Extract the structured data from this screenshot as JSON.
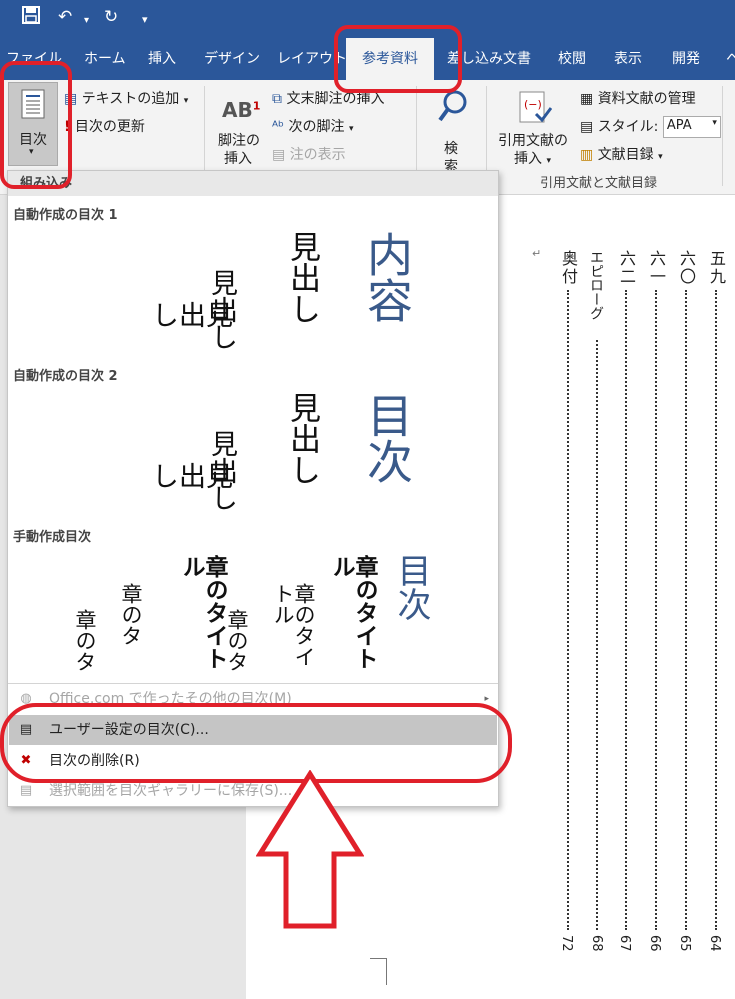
{
  "qat": {
    "save_icon": "save-icon",
    "undo_icon": "undo-icon",
    "redo_icon": "redo-icon",
    "more_icon": "customize-qat-icon"
  },
  "tabs": [
    {
      "label": "ファイル"
    },
    {
      "label": "ホーム"
    },
    {
      "label": "挿入"
    },
    {
      "label": "デザイン"
    },
    {
      "label": "レイアウト"
    },
    {
      "label": "参考資料"
    },
    {
      "label": "差し込み文書"
    },
    {
      "label": "校閲"
    },
    {
      "label": "表示"
    },
    {
      "label": "開発"
    },
    {
      "label": "ヘ"
    }
  ],
  "ribbon": {
    "toc_label": "目次",
    "add_text": "テキストの追加",
    "update_toc": "目次の更新",
    "footnote_insert_line1": "脚注の",
    "footnote_insert_line2": "挿入",
    "endnote_insert": "文末脚注の挿入",
    "next_footnote": "次の脚注",
    "show_notes": "注の表示",
    "search_line1": "検",
    "search_line2": "索",
    "citation_line1": "引用文献の",
    "citation_line2": "挿入",
    "manage_sources": "資料文献の管理",
    "style_label": "スタイル:",
    "style_value": "APA",
    "bibliography": "文献目録",
    "group_citations": "引用文献と文献目録"
  },
  "menu": {
    "header": "組み込み",
    "sections": {
      "auto1": {
        "title": "自動作成の目次 1",
        "big": "内容",
        "h1": "見出し",
        "h2": "見出し",
        "h3": "見出し"
      },
      "auto2": {
        "title": "自動作成の目次 2",
        "big": "目次",
        "h1": "見出し",
        "h2": "見出し",
        "h3": "見出し"
      },
      "manual": {
        "title": "手動作成目次",
        "big": "目次",
        "c1": "章のタイトル",
        "c2": "章のタイトル",
        "c3": "章のタ",
        "c4": "章のタイトル",
        "c5": "章のタ",
        "c6": "章のタ"
      }
    },
    "items": {
      "more": "Office.com で作ったその他の目次(M)",
      "custom": "ユーザー設定の目次(C)...",
      "remove": "目次の削除(R)",
      "save": "選択範囲を目次ギャラリーに保存(S)..."
    }
  },
  "document": {
    "columns": [
      {
        "text": "五九",
        "page": "64"
      },
      {
        "text": "六〇",
        "page": "65"
      },
      {
        "text": "六一",
        "page": "66"
      },
      {
        "text": "六二",
        "page": "67"
      },
      {
        "text": "エピローグ",
        "page": "68"
      },
      {
        "text": "奥付",
        "page": "72"
      }
    ],
    "return_mark": "↵"
  },
  "annotation_color": "#e0202a"
}
